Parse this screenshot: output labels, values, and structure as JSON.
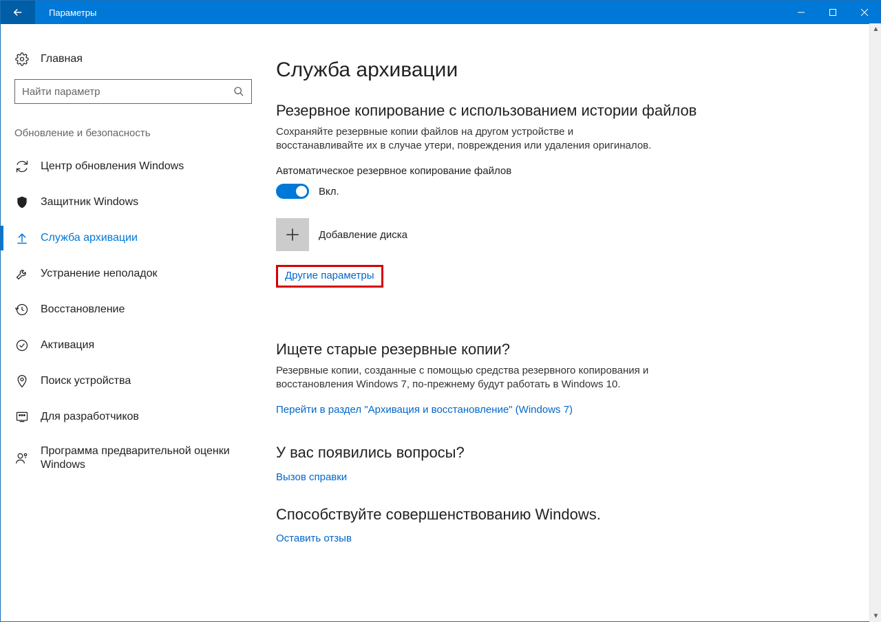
{
  "window": {
    "title": "Параметры"
  },
  "sidebar": {
    "home": "Главная",
    "search_placeholder": "Найти параметр",
    "group": "Обновление и безопасность",
    "items": [
      {
        "label": "Центр обновления Windows",
        "icon": "sync-icon",
        "selected": false
      },
      {
        "label": "Защитник Windows",
        "icon": "shield-icon",
        "selected": false
      },
      {
        "label": "Служба архивации",
        "icon": "backup-arrow-icon",
        "selected": true
      },
      {
        "label": "Устранение неполадок",
        "icon": "wrench-icon",
        "selected": false
      },
      {
        "label": "Восстановление",
        "icon": "history-icon",
        "selected": false
      },
      {
        "label": "Активация",
        "icon": "check-circle-icon",
        "selected": false
      },
      {
        "label": "Поиск устройства",
        "icon": "find-device-icon",
        "selected": false
      },
      {
        "label": "Для разработчиков",
        "icon": "developer-icon",
        "selected": false
      },
      {
        "label": "Программа предварительной оценки Windows",
        "icon": "insider-icon",
        "selected": false
      }
    ]
  },
  "main": {
    "page_title": "Служба архивации",
    "section1": {
      "title": "Резервное копирование с использованием истории файлов",
      "desc": "Сохраняйте резервные копии файлов на другом устройстве и восстанавливайте их в случае утери, повреждения или удаления оригиналов.",
      "auto_label": "Автоматическое резервное копирование файлов",
      "toggle_state": "Вкл.",
      "toggle_on": true,
      "add_drive": "Добавление диска",
      "other_params": "Другие параметры"
    },
    "section2": {
      "title": "Ищете старые резервные копии?",
      "desc": "Резервные копии, созданные с помощью средства резервного копирования и восстановления Windows 7, по-прежнему будут работать в Windows 10.",
      "link": "Перейти в раздел \"Архивация и восстановление\" (Windows 7)"
    },
    "section3": {
      "title": "У вас появились вопросы?",
      "link": "Вызов справки"
    },
    "section4": {
      "title": "Способствуйте совершенствованию Windows.",
      "link": "Оставить отзыв"
    }
  }
}
